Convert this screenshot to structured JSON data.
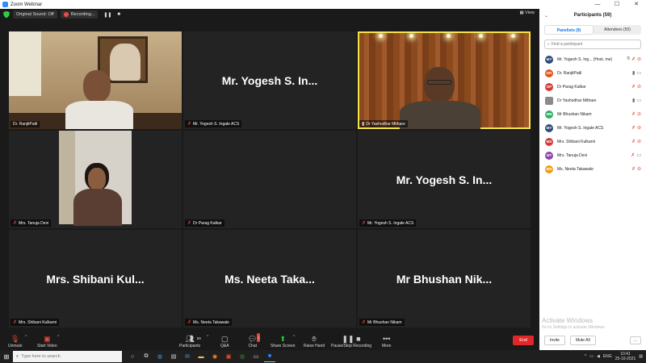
{
  "window": {
    "title": "Zoom Webinar",
    "controls": [
      "—",
      "☐",
      "✕"
    ]
  },
  "topbar": {
    "audio_label": "Original Sound: Off",
    "recording_label": "Recording...",
    "pause_glyph": "❚❚",
    "stop_glyph": "■",
    "view_label": "View"
  },
  "tiles": [
    {
      "label": "Dr. RanjitPatil",
      "muted": true
    },
    {
      "label": "Mr. Yogesh S. Ingale ACS",
      "big": "Mr. Yogesh S. In...",
      "muted": true
    },
    {
      "label": "Dr Yashodhar Mithare",
      "muted": false
    },
    {
      "label": "Mrs. Tanuja Devi",
      "muted": true
    },
    {
      "label": "Dr Parag Kalkar",
      "muted": true
    },
    {
      "label": "Mr. Yogesh S. Ingale ACS",
      "big": "Mr. Yogesh S. In...",
      "muted": true
    },
    {
      "label": "Mrs. Shibani Kulkarni",
      "big": "Mrs. Shibani Kul...",
      "muted": true
    },
    {
      "label": "Ms. Neeta Takawale",
      "big": "Ms. Neeta Taka...",
      "muted": true
    },
    {
      "label": "Mr Bhushan Nikam",
      "big": "Mr Bhushan Nik...",
      "muted": true
    }
  ],
  "toolbar": {
    "unmute": "Unmute",
    "start_video": "Start Video",
    "participants": "Participants",
    "participants_count": "59",
    "qa": "Q&A",
    "chat": "Chat",
    "chat_badge": "1",
    "share_screen": "Share Screen",
    "raise_hand": "Raise Hand",
    "recording": "Pause/Stop Recording",
    "more": "More",
    "end": "End"
  },
  "panel": {
    "title": "Participants (59)",
    "tab_panelists": "Panelists (9)",
    "tab_attendees": "Attendees (50)",
    "search_placeholder": "Find a participant",
    "participants": [
      {
        "initials": "MY",
        "name": "Mr. Yogesh S. Ing... (Host, me)",
        "color": "#2d4b7a",
        "mic": "off",
        "video": "off",
        "extra": "hand"
      },
      {
        "initials": "DR",
        "name": "Dr. RanjitPatil",
        "color": "#e0541c",
        "mic": "on",
        "video": "on"
      },
      {
        "initials": "DP",
        "name": "Dr Parag Kalkar",
        "color": "#d43a3a",
        "mic": "off",
        "video": "off"
      },
      {
        "initials": "",
        "name": "Dr Yashodhar Mithare",
        "color": "#8a8a8a",
        "mic": "on",
        "video": "on",
        "img": true
      },
      {
        "initials": "MB",
        "name": "Mr Bhushan Nikam",
        "color": "#27ae60",
        "mic": "off",
        "video": "off"
      },
      {
        "initials": "MY",
        "name": "Mr. Yogesh S. Ingale ACS",
        "color": "#2d4b7a",
        "mic": "off",
        "video": "off"
      },
      {
        "initials": "MS",
        "name": "Mrs. Shibani Kulkarni",
        "color": "#d43a3a",
        "mic": "off",
        "video": "off"
      },
      {
        "initials": "MT",
        "name": "Mrs. Tanuja Devi",
        "color": "#8e44ad",
        "mic": "off",
        "video": "on"
      },
      {
        "initials": "MN",
        "name": "Ms. Neeta Takawale",
        "color": "#f39c12",
        "mic": "off",
        "video": "off"
      }
    ],
    "activate_title": "Activate Windows",
    "activate_sub": "Go to Settings to activate Windows.",
    "invite": "Invite",
    "mute_all": "Mute All",
    "more": "..."
  },
  "taskbar": {
    "search_placeholder": "Type here to search",
    "lang": "ENG",
    "time": "10:41",
    "date": "25-10-2021"
  }
}
